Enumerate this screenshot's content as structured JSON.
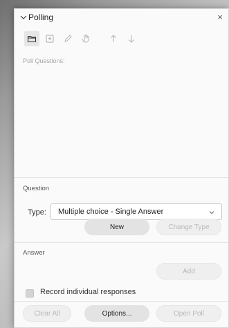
{
  "panel": {
    "title": "Polling",
    "close_glyph": "×"
  },
  "toolbar": {
    "tools": [
      {
        "icon": "folder-icon",
        "active": true
      },
      {
        "icon": "download-icon",
        "active": false
      },
      {
        "icon": "pencil-icon",
        "active": false
      },
      {
        "icon": "hand-icon",
        "active": false
      },
      {
        "icon": "arrow-up-icon",
        "active": false
      },
      {
        "icon": "arrow-down-icon",
        "active": false
      }
    ]
  },
  "poll_questions": {
    "label": "Poll Questions:"
  },
  "question": {
    "section_title": "Question",
    "type_label": "Type:",
    "type_value": "Multiple choice - Single Answer",
    "new_label": "New",
    "change_type_label": "Change Type"
  },
  "answer": {
    "section_title": "Answer",
    "add_label": "Add",
    "record_label": "Record individual responses"
  },
  "footer": {
    "clear_all_label": "Clear All",
    "options_label": "Options...",
    "open_poll_label": "Open Poll"
  },
  "colors": {
    "panel_bg": "#fafafa",
    "button_bg": "#e3e3e3",
    "disabled_text": "#b9b9b9"
  }
}
